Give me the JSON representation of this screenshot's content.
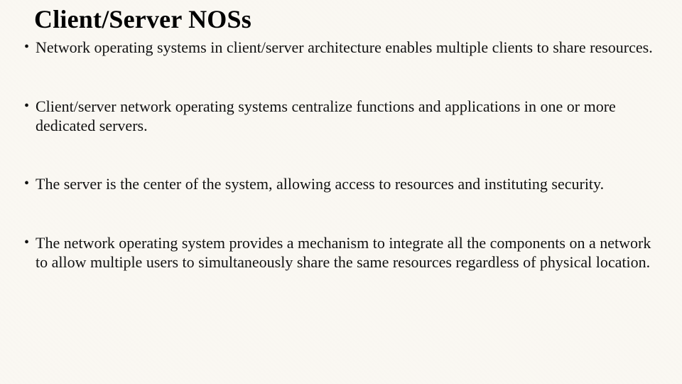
{
  "slide": {
    "title": "Client/Server NOSs",
    "bullets": [
      "Network operating systems in client/server architecture enables multiple clients to share resources.",
      "Client/server network operating systems centralize functions and applications in one or more dedicated servers.",
      "The server is the center of the system, allowing access to resources and instituting security.",
      "The network operating system provides a mechanism to integrate all the components on a network to allow multiple users to simultaneously share the same resources regardless of physical location."
    ]
  }
}
